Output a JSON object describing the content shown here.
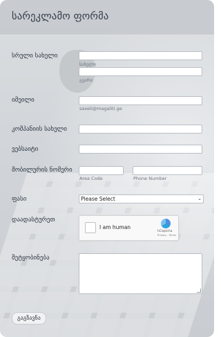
{
  "form": {
    "title": "სარეკლამო ფორმა",
    "fields": {
      "full_name": {
        "label": "სრული სახელი",
        "first_sub": "სახელი",
        "last_sub": "გვარი"
      },
      "email": {
        "label": "იმეილი",
        "sub": "saxeli@magaliti.ge"
      },
      "company": {
        "label": "კომპანიის სახელი"
      },
      "website": {
        "label": "ვებსაიტი"
      },
      "phone": {
        "label": "მობილურის ნომერი",
        "area_sub": "Area Code",
        "number_sub": "Phone Number"
      },
      "price": {
        "label": "ფასი",
        "selected": "Please Select"
      },
      "verify": {
        "label": "დაადასტურეთ"
      },
      "message": {
        "label": "შეტყობინება"
      }
    },
    "captcha": {
      "checkbox_text": "I am human",
      "brand": "hCaptcha",
      "links": "Privacy - Terms"
    },
    "submit_label": "გაგზავნა"
  }
}
